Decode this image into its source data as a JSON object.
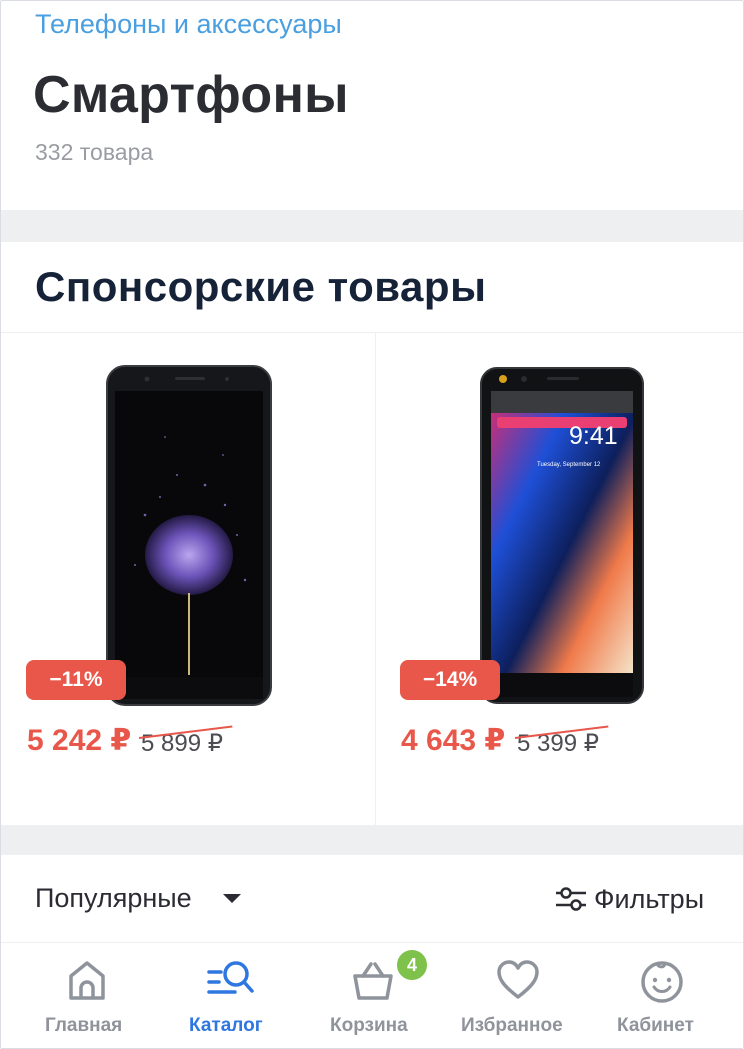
{
  "breadcrumb": "Телефоны и аксессуары",
  "page_title": "Смартфоны",
  "item_count": "332 товара",
  "sponsored": {
    "title": "Спонсорские товары",
    "products": [
      {
        "discount": "−11%",
        "price": "5 242 ₽",
        "old_price": "5 899 ₽"
      },
      {
        "discount": "−14%",
        "price": "4 643 ₽",
        "old_price": "5 399 ₽",
        "screen_time": "9:41",
        "screen_date": "Tuesday, September 12"
      }
    ]
  },
  "sort": {
    "label": "Популярные",
    "filter_label": "Фильтры"
  },
  "tabbar": {
    "home": "Главная",
    "catalog": "Каталог",
    "cart": "Корзина",
    "cart_count": "4",
    "favorites": "Избранное",
    "account": "Кабинет"
  },
  "colors": {
    "accent_blue": "#2e77e0",
    "link_blue": "#4a9fe0",
    "sale_red": "#e8574a",
    "badge_green": "#7ec14b",
    "inactive_gray": "#8f939b"
  }
}
